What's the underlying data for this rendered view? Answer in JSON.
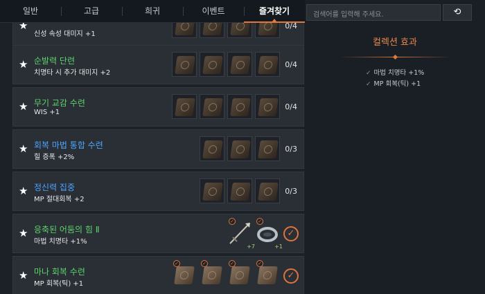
{
  "tabs": [
    "일반",
    "고급",
    "희귀",
    "이벤트",
    "즐겨찾기"
  ],
  "active_tab_index": 4,
  "search": {
    "placeholder": "검색어를 입력해 주세요."
  },
  "panel": {
    "title": "컬렉션 효과",
    "effects": [
      "마법 치명타 +1%",
      "MP 회복(틱) +1"
    ]
  },
  "rows": [
    {
      "title": "",
      "title_color": "green",
      "effect": "신성 속성 대미지 +1",
      "count": "0/4",
      "completed": false
    },
    {
      "title": "순발력 단련",
      "title_color": "green",
      "effect": "치명타 시 추가 대미지 +2",
      "count": "0/4",
      "completed": false
    },
    {
      "title": "무기 교감 수련",
      "title_color": "green",
      "effect": "WIS +1",
      "count": "0/4",
      "completed": false
    },
    {
      "title": "회복 마법 통합 수련",
      "title_color": "blue",
      "effect": "힐 증폭 +2%",
      "count": "0/3",
      "completed": false
    },
    {
      "title": "정신력 집중",
      "title_color": "blue",
      "effect": "MP 절대회복 +2",
      "count": "0/3",
      "completed": false
    },
    {
      "title": "응축된 어둠의 힘 Ⅱ",
      "title_color": "green",
      "effect": "마법 치명타 +1%",
      "count": "",
      "completed": true,
      "item_plus": [
        "+7",
        "+1"
      ]
    },
    {
      "title": "마나 회복 수련",
      "title_color": "green",
      "effect": "MP 회복(틱) +1",
      "count": "",
      "completed": true
    }
  ]
}
